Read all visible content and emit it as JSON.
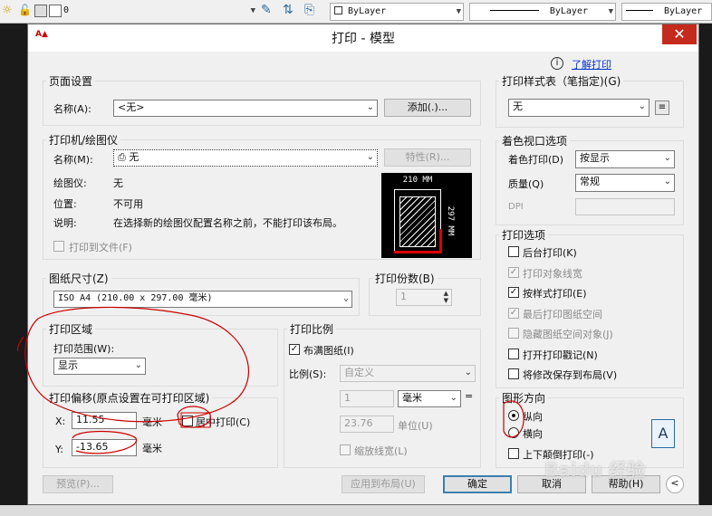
{
  "toolbar": {
    "layer_value": "0",
    "color_value": "ByLayer",
    "linetype_value": "ByLayer",
    "lineweight_value": "ByLayer"
  },
  "dialog": {
    "title": "打印 - 模型",
    "help_link": "了解打印",
    "page_setup": {
      "group": "页面设置",
      "name_label": "名称(A):",
      "name_value": "<无>",
      "add_button": "添加(.)..."
    },
    "printer": {
      "group": "打印机/绘图仪",
      "name_label": "名称(M):",
      "name_value": "无",
      "properties_button": "特性(R)...",
      "plotter_label": "绘图仪:",
      "plotter_value": "无",
      "location_label": "位置:",
      "location_value": "不可用",
      "description_label": "说明:",
      "description_value": "在选择新的绘图仪配置名称之前，不能打印该布局。",
      "plot_to_file": "打印到文件(F)",
      "preview_width": "210 MM",
      "preview_height": "297 MM"
    },
    "paper_size": {
      "group": "图纸尺寸(Z)",
      "value": "ISO A4 (210.00 x 297.00 毫米)"
    },
    "copies": {
      "group": "打印份数(B)",
      "value": "1"
    },
    "plot_area": {
      "group": "打印区域",
      "range_label": "打印范围(W):",
      "range_value": "显示"
    },
    "plot_offset": {
      "group": "打印偏移(原点设置在可打印区域)",
      "x_label": "X:",
      "x_value": "11.55",
      "x_unit": "毫米",
      "y_label": "Y:",
      "y_value": "-13.65",
      "y_unit": "毫米",
      "center_plot": "居中打印(C)"
    },
    "plot_scale": {
      "group": "打印比例",
      "fit_paper": "布满图纸(I)",
      "scale_label": "比例(S):",
      "scale_value": "自定义",
      "value1": "1",
      "unit_value": "毫米",
      "equals": "=",
      "value2": "23.76",
      "unit2_label": "单位(U)",
      "scale_lineweights": "缩放线宽(L)"
    },
    "plot_style_table": {
      "group": "打印样式表（笔指定)(G)",
      "value": "无"
    },
    "shaded_viewport": {
      "group": "着色视口选项",
      "shade_plot_label": "着色打印(D)",
      "shade_plot_value": "按显示",
      "quality_label": "质量(Q)",
      "quality_value": "常规",
      "dpi_label": "DPI"
    },
    "plot_options": {
      "group": "打印选项",
      "items": [
        {
          "label": "后台打印(K)",
          "checked": false,
          "disabled": false
        },
        {
          "label": "打印对象线宽",
          "checked": true,
          "disabled": true
        },
        {
          "label": "按样式打印(E)",
          "checked": true,
          "disabled": false
        },
        {
          "label": "最后打印图纸空间",
          "checked": true,
          "disabled": true
        },
        {
          "label": "隐藏图纸空间对象(J)",
          "checked": false,
          "disabled": true
        },
        {
          "label": "打开打印戳记(N)",
          "checked": false,
          "disabled": false
        },
        {
          "label": "将修改保存到布局(V)",
          "checked": false,
          "disabled": false
        }
      ]
    },
    "orientation": {
      "group": "图形方向",
      "portrait": "纵向",
      "landscape": "横向",
      "upside_down": "上下颠倒打印(-)",
      "icon_letter": "A"
    },
    "buttons": {
      "preview": "预览(P)...",
      "apply_layout": "应用到布局(U)",
      "ok": "确定",
      "cancel": "取消",
      "help": "帮助(H)",
      "more": "<"
    },
    "watermark": "Baidu 经验"
  },
  "colors": {
    "accent": "#3c7fb1",
    "close": "#c42b1c",
    "annotation_red": "#cc0000"
  }
}
